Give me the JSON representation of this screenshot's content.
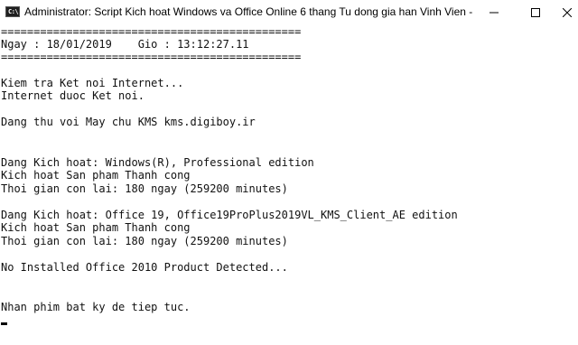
{
  "window": {
    "title": "Administrator:  Script Kich hoat Windows va Office Online 6 thang Tu dong gia han Vinh Vien - Copyright",
    "icon": "cmd-icon",
    "icon_glyph": "C:\\"
  },
  "console": {
    "lines": [
      "==============================================",
      "Ngay : 18/01/2019    Gio : 13:12:27.11",
      "==============================================",
      "",
      "Kiem tra Ket noi Internet...",
      "Internet duoc Ket noi.",
      "",
      "Dang thu voi May chu KMS kms.digiboy.ir",
      "",
      "",
      "Dang Kich hoat: Windows(R), Professional edition",
      "Kich hoat San pham Thanh cong",
      "Thoi gian con lai: 180 ngay (259200 minutes)",
      "",
      "Dang Kich hoat: Office 19, Office19ProPlus2019VL_KMS_Client_AE edition",
      "Kich hoat San pham Thanh cong",
      "Thoi gian con lai: 180 ngay (259200 minutes)",
      "",
      "No Installed Office 2010 Product Detected...",
      "",
      "",
      "Nhan phim bat ky de tiep tuc."
    ]
  }
}
